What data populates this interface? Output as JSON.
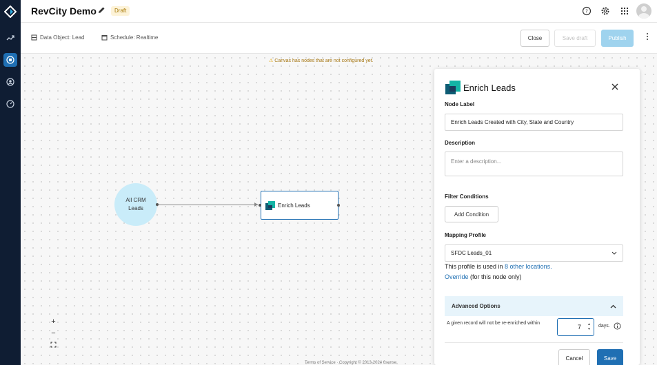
{
  "app": {
    "title": "RevCity Demo",
    "status_badge": "Draft"
  },
  "rail": {
    "items": [
      "logo-icon",
      "trend-icon",
      "workflow-icon",
      "user-icon",
      "gauge-icon"
    ]
  },
  "subbar": {
    "data_object": "Data Object: Lead",
    "schedule": "Schedule: Realtime",
    "close_label": "Close",
    "save_draft_label": "Save draft",
    "publish_label": "Publish"
  },
  "canvas": {
    "warning": "Canvas has nodes that are not configured yet.",
    "source_node_label": "All CRM Leads",
    "enrich_node_label": "Enrich Leads",
    "zoom_in": "+",
    "zoom_out": "−",
    "footer": "Terms of Service · Copyright © 2013-2024 6sense"
  },
  "panel": {
    "title": "Enrich Leads",
    "node_label_heading": "Node Label",
    "node_label_value": "Enrich Leads Created with City, State and Country",
    "description_heading": "Description",
    "description_placeholder": "Enter a description...",
    "filter_heading": "Filter Conditions",
    "add_condition_label": "Add Condition",
    "mapping_heading": "Mapping Profile",
    "mapping_value": "SFDC Leads_01",
    "usage_prefix": "This profile is used in ",
    "usage_link": "8 other locations.",
    "override_link": "Override",
    "override_suffix": " (for this node only)",
    "advanced_heading": "Advanced Options",
    "reenrich_text": "A given record will not be re-enriched within",
    "reenrich_days_value": "7",
    "days_label": "days.",
    "cancel_label": "Cancel",
    "save_label": "Save"
  },
  "colors": {
    "accent": "#1f6fb3",
    "rail_bg": "#0f1d33",
    "publish_disabled": "#9fd3ee",
    "source_node_fill": "#c9ecf9",
    "enrich_icon": "#13b4a6"
  }
}
